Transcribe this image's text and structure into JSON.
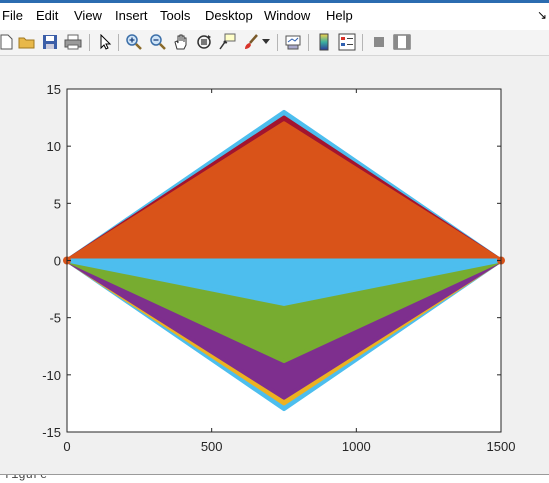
{
  "menu": {
    "items": [
      "File",
      "Edit",
      "View",
      "Insert",
      "Tools",
      "Desktop",
      "Window",
      "Help"
    ],
    "overflow_arrow": "↘"
  },
  "toolbar": {
    "icons": [
      "new-figure-icon",
      "open-file-icon",
      "save-icon",
      "print-icon",
      "select-arrow-icon",
      "zoom-in-icon",
      "zoom-out-icon",
      "pan-hand-icon",
      "rotate-3d-icon",
      "data-cursor-icon",
      "brush-icon",
      "brush-dropdown-icon",
      "link-plot-icon",
      "colorbar-icon",
      "legend-icon",
      "hide-plot-tools-icon",
      "show-plot-tools-icon"
    ]
  },
  "chart_data": {
    "type": "area",
    "title": "",
    "xlabel": "",
    "ylabel": "",
    "xlim": [
      0,
      1500
    ],
    "ylim": [
      -15,
      15
    ],
    "xticks": [
      "0",
      "500",
      "1000",
      "1500"
    ],
    "yticks": [
      "15",
      "10",
      "5",
      "0",
      "-5",
      "-10",
      "-15"
    ],
    "grid": false,
    "x": [
      0,
      750,
      1500
    ],
    "series": [
      {
        "color": "#4DBEEE",
        "values": [
          0,
          13.0,
          0
        ]
      },
      {
        "color": "#A2142F",
        "values": [
          0,
          12.5,
          0
        ]
      },
      {
        "color": "#D95319",
        "values": [
          0,
          12.0,
          0
        ]
      },
      {
        "color": "#4DBEEE",
        "values": [
          0,
          -13.0,
          0
        ]
      },
      {
        "color": "#EDB120",
        "values": [
          0,
          -12.5,
          0
        ]
      },
      {
        "color": "#7E2F8E",
        "values": [
          0,
          -12.0,
          0
        ]
      },
      {
        "color": "#77AC30",
        "values": [
          0,
          -8.8,
          0
        ]
      },
      {
        "color": "#4DBEEE",
        "values": [
          0,
          -3.8,
          0
        ]
      }
    ]
  },
  "command_window": {
    "text": "figure"
  }
}
